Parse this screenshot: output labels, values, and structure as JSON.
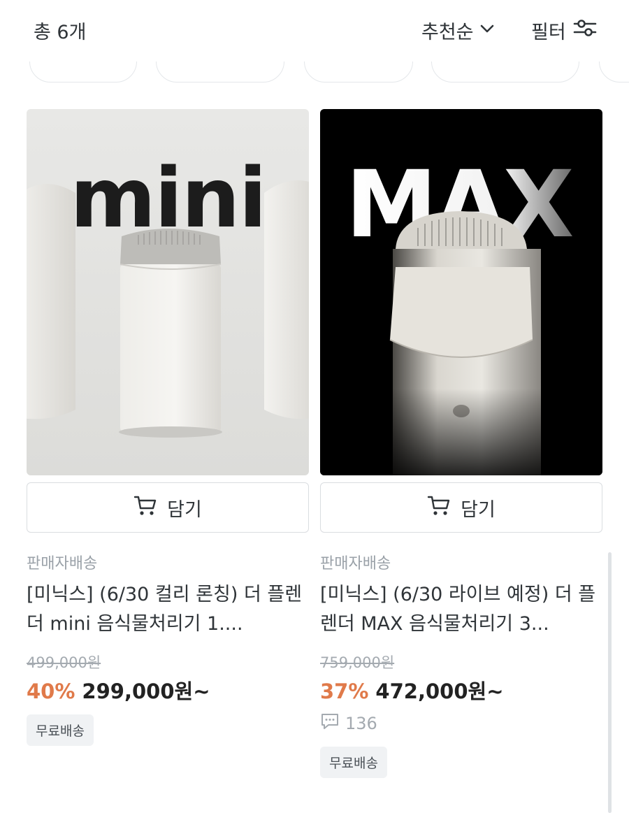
{
  "header": {
    "total_label": "총 6개",
    "sort_label": "추천순",
    "filter_label": "필터"
  },
  "products": [
    {
      "image_text": "mini",
      "cart_label": "담기",
      "shipping_type": "판매자배송",
      "title": "[미닉스] (6/30 컬리 론칭) 더 플렌더 mini 음식물처리기 1....",
      "original_price": "499,000원",
      "discount": "40%",
      "price": "299,000원~",
      "badge": "무료배송"
    },
    {
      "image_text": "MAX",
      "cart_label": "담기",
      "shipping_type": "판매자배송",
      "title": "[미닉스] (6/30 라이브 예정) 더 플렌더 MAX 음식물처리기 3...",
      "original_price": "759,000원",
      "discount": "37%",
      "price": "472,000원~",
      "review_count": "136",
      "badge": "무료배송"
    }
  ],
  "icons": {
    "sort": "chevron-down-icon",
    "filter": "sliders-icon",
    "cart": "cart-icon",
    "review": "speech-bubble-icon"
  },
  "colors": {
    "discount": "#e07a4a",
    "text": "#2f3438",
    "muted": "#9aa1a8"
  }
}
